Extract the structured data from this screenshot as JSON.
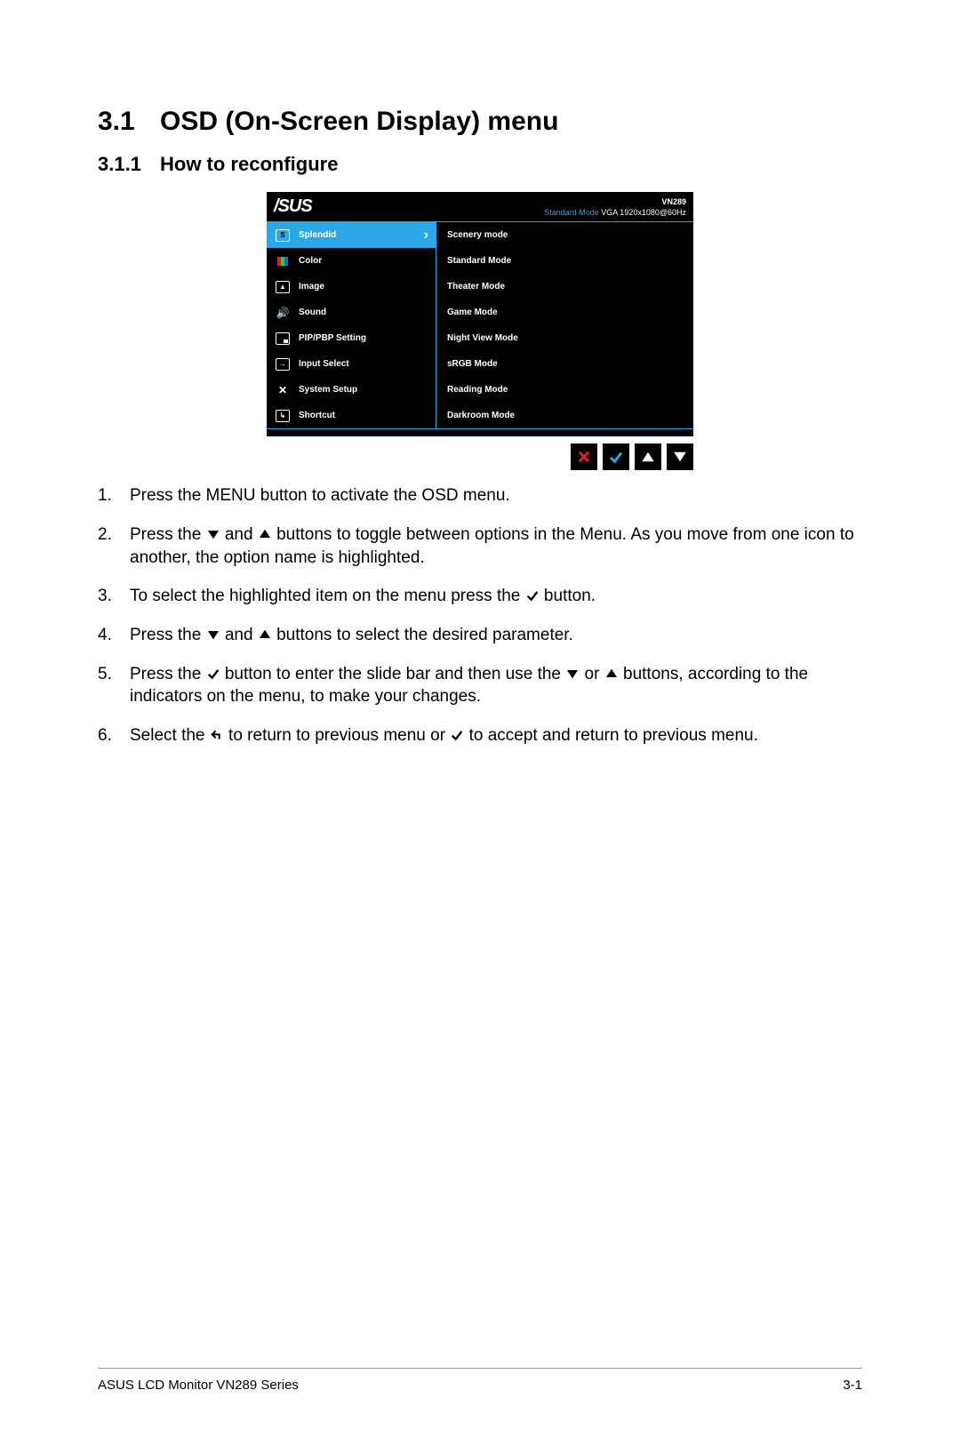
{
  "section_number": "3.1",
  "section_title": "OSD (On-Screen Display) menu",
  "subsection_number": "3.1.1",
  "subsection_title": "How to reconfigure",
  "osd": {
    "brand": "/SUS",
    "model": "VN289",
    "status_mode": "Standard Mode",
    "status_input": "VGA  1920x1080@60Hz",
    "left_items": [
      {
        "label": "Splendid",
        "icon": "s",
        "selected": true
      },
      {
        "label": "Color",
        "icon": "rgb"
      },
      {
        "label": "Image",
        "icon": "image"
      },
      {
        "label": "Sound",
        "icon": "sound"
      },
      {
        "label": "PIP/PBP Setting",
        "icon": "pip"
      },
      {
        "label": "Input Select",
        "icon": "input"
      },
      {
        "label": "System Setup",
        "icon": "setup"
      },
      {
        "label": "Shortcut",
        "icon": "shortcut"
      }
    ],
    "right_items": [
      "Scenery mode",
      "Standard Mode",
      "Theater Mode",
      "Game Mode",
      "Night View Mode",
      "sRGB Mode",
      "Reading Mode",
      "Darkroom Mode"
    ]
  },
  "steps": [
    {
      "n": "1.",
      "parts": [
        {
          "text": "Press the MENU button to activate the OSD menu."
        }
      ]
    },
    {
      "n": "2.",
      "parts": [
        {
          "text": "Press the "
        },
        {
          "icon": "down"
        },
        {
          "text": " and "
        },
        {
          "icon": "up"
        },
        {
          "text": " buttons to toggle between options in the Menu. As you move from one icon to another, the option name is highlighted."
        }
      ]
    },
    {
      "n": "3.",
      "parts": [
        {
          "text": "To select the highlighted item on the menu press the "
        },
        {
          "icon": "check"
        },
        {
          "text": " button."
        }
      ]
    },
    {
      "n": "4.",
      "parts": [
        {
          "text": "Press the "
        },
        {
          "icon": "down"
        },
        {
          "text": " and "
        },
        {
          "icon": "up"
        },
        {
          "text": " buttons to select the desired parameter."
        }
      ]
    },
    {
      "n": "5.",
      "parts": [
        {
          "text": "Press the "
        },
        {
          "icon": "check"
        },
        {
          "text": " button to enter the slide bar and then use the "
        },
        {
          "icon": "down"
        },
        {
          "text": " or "
        },
        {
          "icon": "up"
        },
        {
          "text": " buttons, according to the indicators on the menu, to make your changes."
        }
      ]
    },
    {
      "n": "6.",
      "parts": [
        {
          "text": "Select the "
        },
        {
          "icon": "back"
        },
        {
          "text": " to return to previous menu or "
        },
        {
          "icon": "check"
        },
        {
          "text": " to accept and return to previous menu."
        }
      ]
    }
  ],
  "footer_left": "ASUS LCD Monitor VN289 Series",
  "footer_right": "3-1"
}
